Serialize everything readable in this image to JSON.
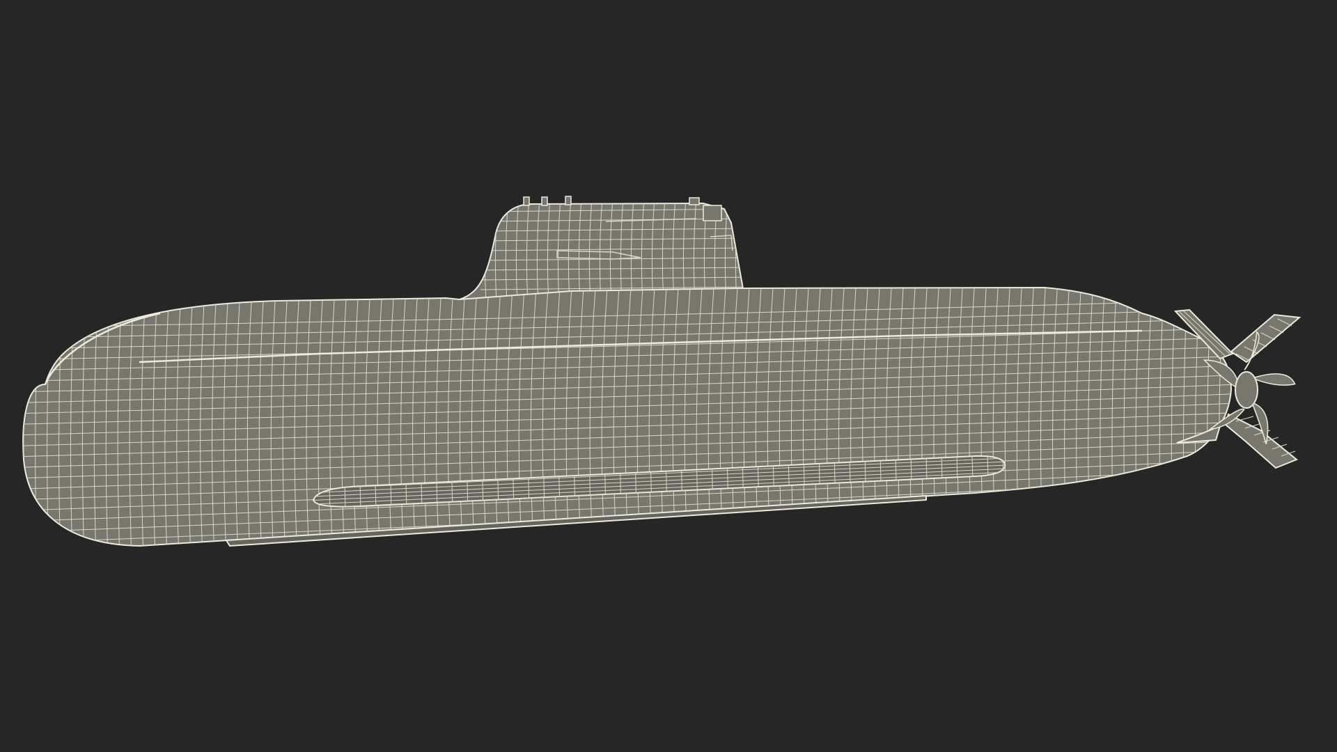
{
  "scene": {
    "subject": "submarine-wireframe",
    "render_mode": "wireframe",
    "colors": {
      "background": "#262626",
      "hull_fill": "#77776e",
      "hull_shadow": "#66665e",
      "wire": "#ecebdc",
      "wire_soft": "#d9d8c8"
    }
  }
}
